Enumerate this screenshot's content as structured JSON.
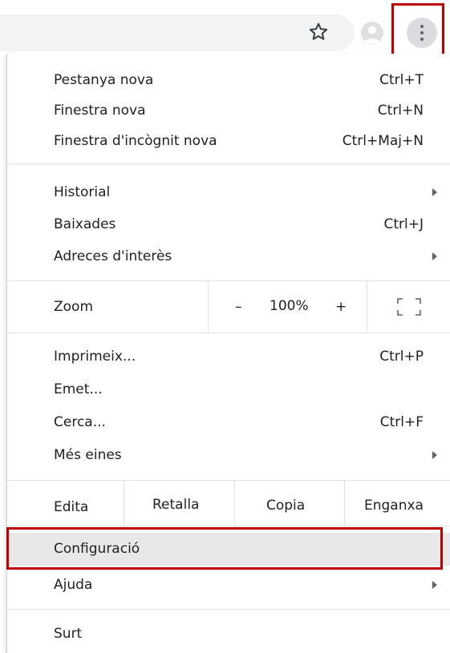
{
  "toolbar": {
    "icons": [
      "star-icon",
      "avatar-icon",
      "kebab-menu-icon"
    ]
  },
  "menu": {
    "group1": [
      {
        "label": "Pestanya nova",
        "shortcut": "Ctrl+T"
      },
      {
        "label": "Finestra nova",
        "shortcut": "Ctrl+N"
      },
      {
        "label": "Finestra d'incògnit nova",
        "shortcut": "Ctrl+Maj+N"
      }
    ],
    "group2": [
      {
        "label": "Historial",
        "shortcut": ""
      },
      {
        "label": "Baixades",
        "shortcut": "Ctrl+J"
      },
      {
        "label": "Adreces d'interès",
        "shortcut": ""
      }
    ],
    "zoom": {
      "label": "Zoom",
      "minus": "–",
      "value": "100%",
      "plus": "+"
    },
    "group3": [
      {
        "label": "Imprimeix...",
        "shortcut": "Ctrl+P"
      },
      {
        "label": "Emet...",
        "shortcut": ""
      },
      {
        "label": "Cerca...",
        "shortcut": "Ctrl+F"
      },
      {
        "label": "Més eines",
        "shortcut": ""
      }
    ],
    "edit": {
      "label": "Edita",
      "cut": "Retalla",
      "copy": "Copia",
      "paste": "Enganxa"
    },
    "group4": [
      {
        "label": "Configuració"
      },
      {
        "label": "Ajuda"
      }
    ],
    "exit": {
      "label": "Surt"
    }
  },
  "colors": {
    "highlight": "#c00000",
    "hover": "#e8e8e8",
    "separator": "#e3e3e3"
  }
}
